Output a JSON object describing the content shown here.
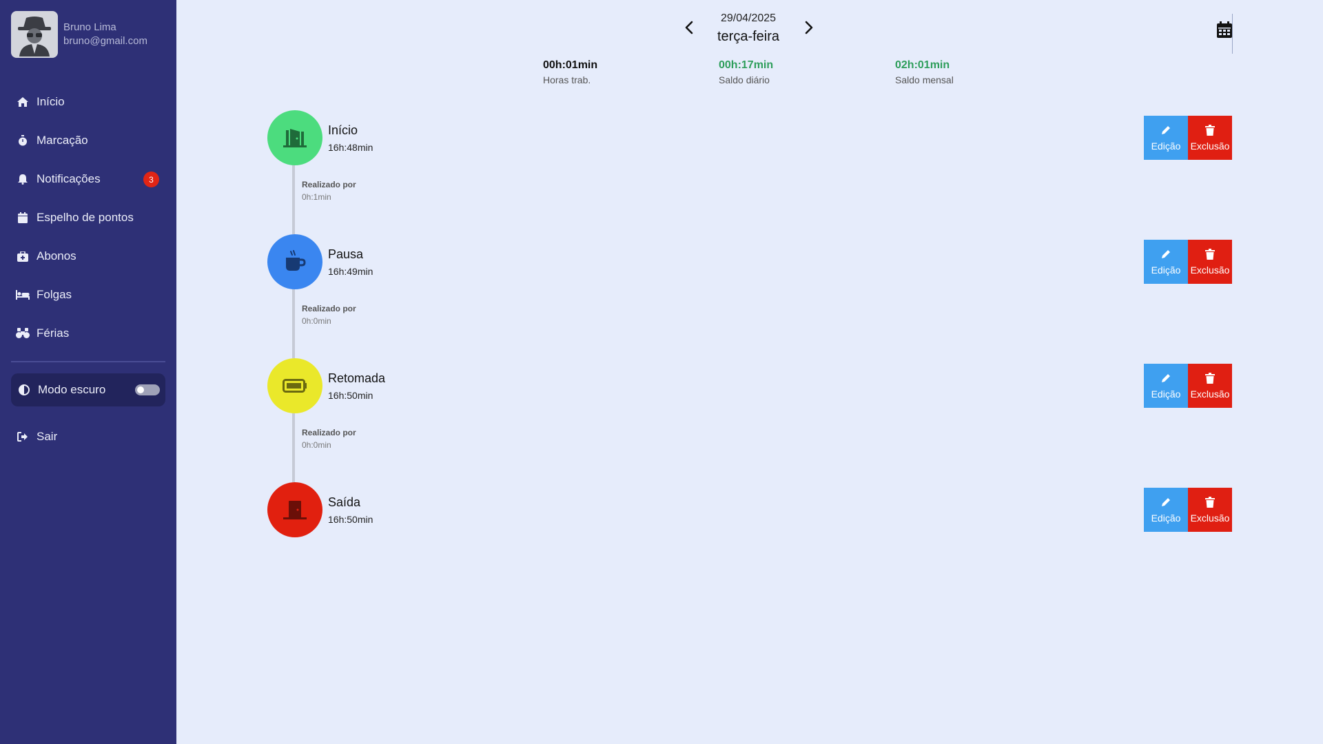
{
  "user": {
    "name": "Bruno Lima",
    "email": "bruno@gmail.com"
  },
  "nav": {
    "items": [
      {
        "label": "Início",
        "icon": "home-icon"
      },
      {
        "label": "Marcação",
        "icon": "stopwatch-icon"
      },
      {
        "label": "Notificações",
        "icon": "bell-icon",
        "badge": "3"
      },
      {
        "label": "Espelho de pontos",
        "icon": "calendar-icon"
      },
      {
        "label": "Abonos",
        "icon": "medkit-icon"
      },
      {
        "label": "Folgas",
        "icon": "bed-icon"
      },
      {
        "label": "Férias",
        "icon": "binoculars-icon"
      }
    ],
    "dark_mode_label": "Modo escuro",
    "dark_mode_on": false,
    "logout_label": "Sair"
  },
  "header": {
    "date": "29/04/2025",
    "weekday": "terça-feira"
  },
  "stats": [
    {
      "value": "00h:01min",
      "label": "Horas trab.",
      "color": "#111111"
    },
    {
      "value": "00h:17min",
      "label": "Saldo diário",
      "color": "#2e9e5b"
    },
    {
      "value": "02h:01min",
      "label": "Saldo mensal",
      "color": "#2e9e5b"
    }
  ],
  "events": [
    {
      "title": "Início",
      "time": "16h:48min",
      "color": "#4cdc7e",
      "icon": "door-open-icon",
      "edit_label": "Edição",
      "delete_label": "Exclusão"
    },
    {
      "title": "Pausa",
      "time": "16h:49min",
      "color": "#3a86f0",
      "icon": "coffee-icon",
      "edit_label": "Edição",
      "delete_label": "Exclusão"
    },
    {
      "title": "Retomada",
      "time": "16h:50min",
      "color": "#eae82a",
      "icon": "battery-icon",
      "edit_label": "Edição",
      "delete_label": "Exclusão"
    },
    {
      "title": "Saída",
      "time": "16h:50min",
      "color": "#e1200f",
      "icon": "door-closed-icon",
      "edit_label": "Edição",
      "delete_label": "Exclusão"
    }
  ],
  "gaps": [
    {
      "label": "Realizado por",
      "duration": "0h:1min"
    },
    {
      "label": "Realizado por",
      "duration": "0h:0min"
    },
    {
      "label": "Realizado por",
      "duration": "0h:0min"
    }
  ]
}
